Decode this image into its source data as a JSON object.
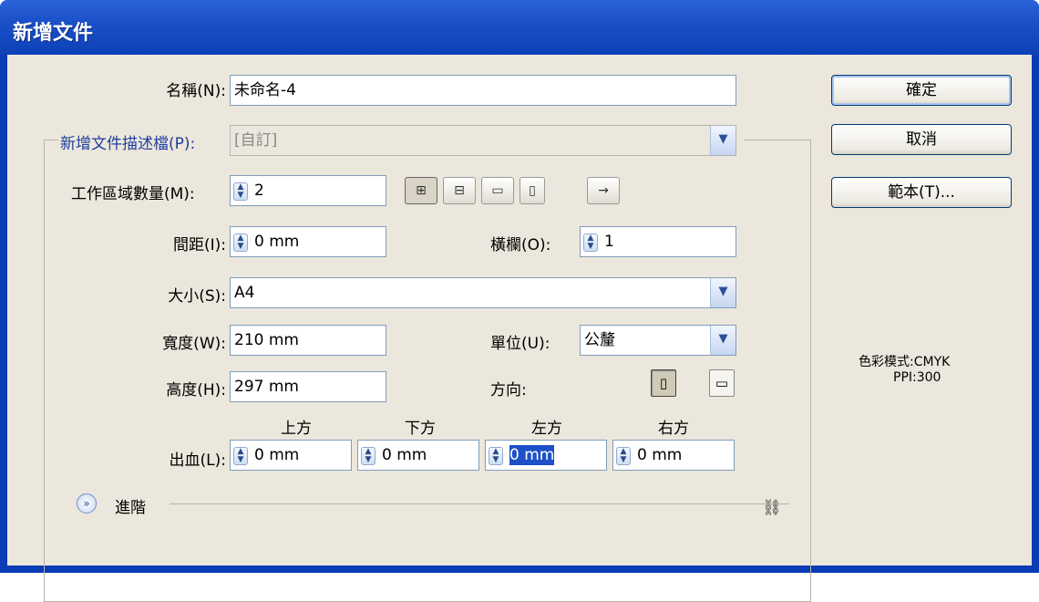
{
  "window": {
    "title": "新增文件"
  },
  "name": {
    "label": "名稱(N):",
    "value": "未命名-4"
  },
  "profile": {
    "label": "新增文件描述檔(P):",
    "value": "[自訂]"
  },
  "artboards": {
    "count_label": "工作區域數量(M):",
    "count_value": "2",
    "layout_icons": [
      "grid-by-row-icon",
      "grid-by-column-icon",
      "arrange-by-row-icon",
      "arrange-by-column-icon",
      "right-to-left-icon"
    ],
    "spacing_label": "間距(I):",
    "spacing_value": "0 mm",
    "columns_label": "橫欄(O):",
    "columns_value": "1"
  },
  "size": {
    "label": "大小(S):",
    "value": "A4"
  },
  "width": {
    "label": "寬度(W):",
    "value": "210 mm"
  },
  "height": {
    "label": "高度(H):",
    "value": "297 mm"
  },
  "units": {
    "label": "單位(U):",
    "value": "公釐"
  },
  "orientation": {
    "label": "方向:",
    "selected": "portrait"
  },
  "bleed": {
    "label": "出血(L):",
    "top_label": "上方",
    "top_value": "0 mm",
    "bottom_label": "下方",
    "bottom_value": "0 mm",
    "left_label": "左方",
    "left_value": "0 mm",
    "right_label": "右方",
    "right_value": "0 mm"
  },
  "advanced": {
    "label": "進階"
  },
  "buttons": {
    "ok": "確定",
    "cancel": "取消",
    "templates": "範本(T)..."
  },
  "info": {
    "color_mode": "色彩模式:CMYK",
    "ppi": "PPI:300"
  },
  "colors": {
    "titlebar": "#0d41b8",
    "dialog_bg": "#ece7dc",
    "accent_blue": "#1e3f9c",
    "selection": "#1e50c8"
  }
}
